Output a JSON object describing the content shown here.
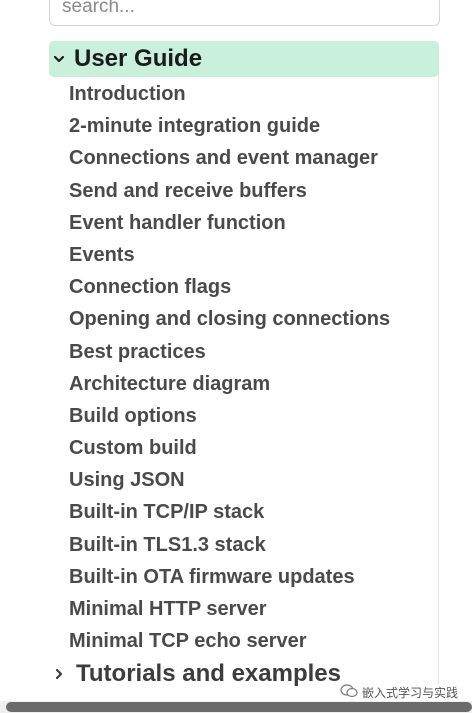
{
  "search": {
    "placeholder": "search..."
  },
  "user_guide": {
    "title": "User Guide",
    "expanded": true,
    "highlight_color": "#c8f0dc",
    "items": [
      "Introduction",
      "2-minute integration guide",
      "Connections and event manager",
      "Send and receive buffers",
      "Event handler function",
      "Events",
      "Connection flags",
      "Opening and closing connections",
      "Best practices",
      "Architecture diagram",
      "Build options",
      "Custom build",
      "Using JSON",
      "Built-in TCP/IP stack",
      "Built-in TLS1.3 stack",
      "Built-in OTA firmware updates",
      "Minimal HTTP server",
      "Minimal TCP echo server"
    ]
  },
  "tutorials": {
    "title": "Tutorials and examples",
    "expanded": false
  },
  "watermark": {
    "text": "嵌入式学习与实践",
    "icon": "wechat-icon"
  }
}
